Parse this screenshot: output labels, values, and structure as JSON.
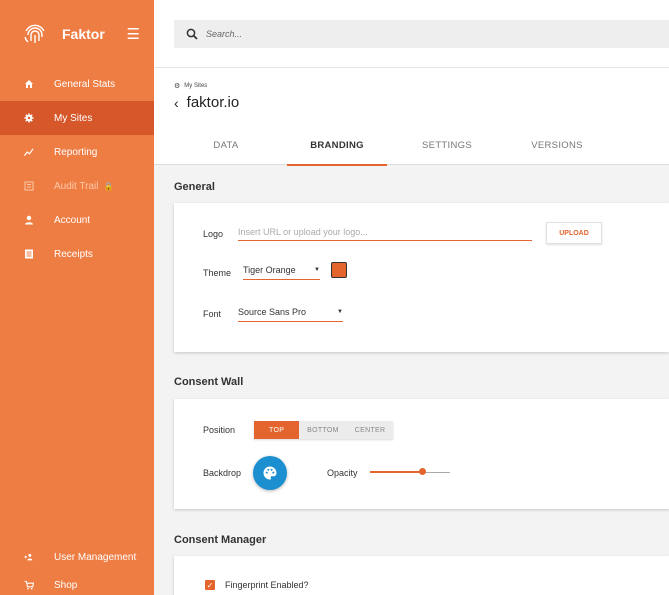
{
  "brand": {
    "name": "Faktor",
    "menu_icon": "hamburger-icon"
  },
  "sidebar": {
    "items": [
      {
        "label": "General Stats",
        "icon": "home-icon"
      },
      {
        "label": "My Sites",
        "icon": "gear-icon",
        "active": true
      },
      {
        "label": "Reporting",
        "icon": "chart-line-icon"
      },
      {
        "label": "Audit Trail",
        "icon": "list-icon",
        "locked": true
      },
      {
        "label": "Account",
        "icon": "user-icon"
      },
      {
        "label": "Receipts",
        "icon": "receipt-icon"
      }
    ],
    "bottom_items": [
      {
        "label": "User Management",
        "icon": "add-users-icon"
      },
      {
        "label": "Shop",
        "icon": "cart-icon"
      }
    ]
  },
  "search": {
    "placeholder": "Search..."
  },
  "breadcrumb": {
    "label": "My Sites"
  },
  "site": {
    "title": "faktor.io"
  },
  "tabs": [
    "DATA",
    "BRANDING",
    "SETTINGS",
    "VERSIONS"
  ],
  "active_tab": "BRANDING",
  "general": {
    "title": "General",
    "logo_label": "Logo",
    "logo_placeholder": "Insert URL or upload your logo...",
    "upload_label": "UPLOAD",
    "theme_label": "Theme",
    "theme_value": "Tiger Orange",
    "theme_color": "#e4642d",
    "font_label": "Font",
    "font_value": "Source Sans Pro"
  },
  "consent_wall": {
    "title": "Consent Wall",
    "position_label": "Position",
    "positions": [
      "TOP",
      "BOTTOM",
      "CENTER"
    ],
    "selected_position": "TOP",
    "backdrop_label": "Backdrop",
    "opacity_label": "Opacity",
    "opacity_value": 0.65
  },
  "consent_manager": {
    "title": "Consent Manager",
    "fingerprint_label": "Fingerprint Enabled?",
    "fingerprint_checked": true
  },
  "colors": {
    "accent": "#e4642d",
    "sidebar": "#ee7d44",
    "sidebar_active": "#d5572a",
    "fab": "#1b8fd0"
  }
}
